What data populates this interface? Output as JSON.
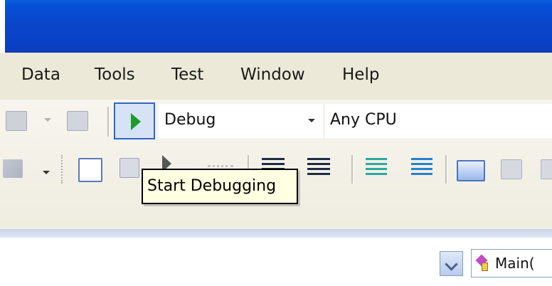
{
  "menu": {
    "items": [
      "Data",
      "Tools",
      "Test",
      "Window",
      "Help"
    ]
  },
  "toolbar": {
    "configuration": "Debug",
    "platform": "Any CPU"
  },
  "tooltip": {
    "text": "Start Debugging"
  },
  "navigation": {
    "member": "Main("
  },
  "colors": {
    "titlebar": "#0a44c8",
    "menubar": "#ece9d8",
    "toolbar_bg": "#f3f1e7",
    "start_button_border": "#2f66c8",
    "start_button_fill": "#d6e3f7",
    "play_icon": "#1d9c2a",
    "tooltip_bg": "#ffffe1"
  },
  "icons": {
    "start": "play-icon",
    "member": "method-icon"
  }
}
